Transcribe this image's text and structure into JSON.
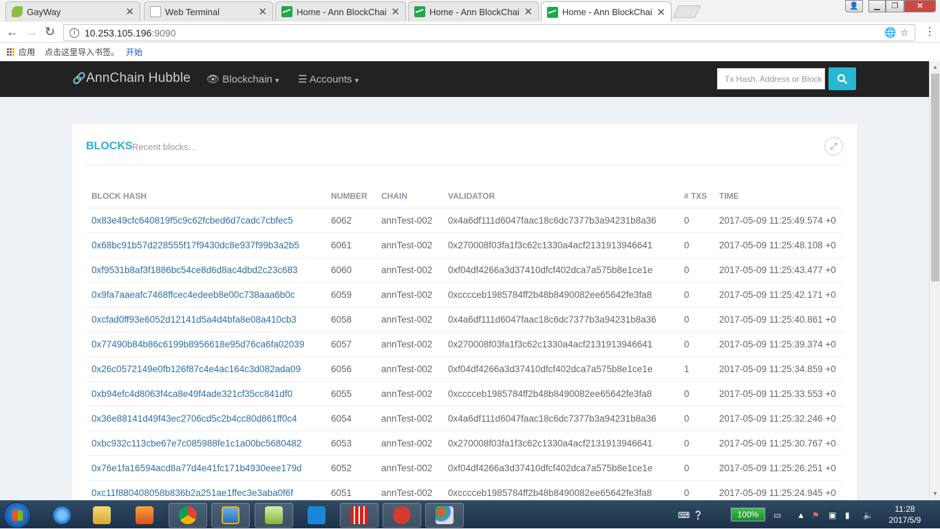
{
  "browser": {
    "tabs": [
      {
        "title": "GayWay",
        "favicon": "leaf-icon",
        "active": false
      },
      {
        "title": "Web Terminal",
        "favicon": "document-icon",
        "active": false
      },
      {
        "title": "Home - Ann BlockChain",
        "favicon": "chart-icon",
        "active": false
      },
      {
        "title": "Home - Ann BlockChain",
        "favicon": "chart-icon",
        "active": false
      },
      {
        "title": "Home - Ann BlockChain",
        "favicon": "chart-icon",
        "active": true
      }
    ],
    "url_host": "10.253.105.196",
    "url_port": ":9090",
    "bookmarks": {
      "apps_label": "应用",
      "import_text": "点击这里导入书签。",
      "start_link": "开始"
    }
  },
  "nav": {
    "brand": "AnnChain Hubble",
    "blockchain_menu": "Blockchain",
    "accounts_menu": "Accounts",
    "search_placeholder": "Tx Hash, Address or Block"
  },
  "card": {
    "title": "BLOCKS",
    "subtitle": "Recent blocks...",
    "columns": [
      "BLOCK HASH",
      "NUMBER",
      "CHAIN",
      "VALIDATOR",
      "# TXS",
      "TIME"
    ],
    "rows": [
      {
        "hash": "0x83e49cfc640819f5c9c62fcbed6d7cadc7cbfec5",
        "number": "6062",
        "chain": "annTest-002",
        "validator": "0x4a6df111d6047faac18c6dc7377b3a94231b8a36",
        "txs": "0",
        "time": "2017-05-09 11:25:49.574 +0"
      },
      {
        "hash": "0x68bc91b57d228555f17f9430dc8e937f99b3a2b5",
        "number": "6061",
        "chain": "annTest-002",
        "validator": "0x270008f03fa1f3c62c1330a4acf2131913946641",
        "txs": "0",
        "time": "2017-05-09 11:25:48.108 +0"
      },
      {
        "hash": "0xf9531b8af3f1886bc54ce8d6d8ac4dbd2c23c683",
        "number": "6060",
        "chain": "annTest-002",
        "validator": "0xf04df4266a3d37410dfcf402dca7a575b8e1ce1e",
        "txs": "0",
        "time": "2017-05-09 11:25:43.477 +0"
      },
      {
        "hash": "0x9fa7aaeafc7468ffcec4edeeb8e00c738aaa6b0c",
        "number": "6059",
        "chain": "annTest-002",
        "validator": "0xcccceb1985784ff2b48b8490082ee65642fe3fa8",
        "txs": "0",
        "time": "2017-05-09 11:25:42.171 +0"
      },
      {
        "hash": "0xcfad0ff93e6052d12141d5a4d4bfa8e08a410cb3",
        "number": "6058",
        "chain": "annTest-002",
        "validator": "0x4a6df111d6047faac18c6dc7377b3a94231b8a36",
        "txs": "0",
        "time": "2017-05-09 11:25:40.861 +0"
      },
      {
        "hash": "0x77490b84b86c6199b8956618e95d76ca6fa02039",
        "number": "6057",
        "chain": "annTest-002",
        "validator": "0x270008f03fa1f3c62c1330a4acf2131913946641",
        "txs": "0",
        "time": "2017-05-09 11:25:39.374 +0"
      },
      {
        "hash": "0x26c0572149e0fb126f87c4e4ac164c3d082ada09",
        "number": "6056",
        "chain": "annTest-002",
        "validator": "0xf04df4266a3d37410dfcf402dca7a575b8e1ce1e",
        "txs": "1",
        "time": "2017-05-09 11:25:34.859 +0"
      },
      {
        "hash": "0xb94efc4d8063f4ca8e49f4ade321cf35cc841df0",
        "number": "6055",
        "chain": "annTest-002",
        "validator": "0xcccceb1985784ff2b48b8490082ee65642fe3fa8",
        "txs": "0",
        "time": "2017-05-09 11:25:33.553 +0"
      },
      {
        "hash": "0x36e88141d49f43ec2706cd5c2b4cc80d861ff0c4",
        "number": "6054",
        "chain": "annTest-002",
        "validator": "0x4a6df111d6047faac18c6dc7377b3a94231b8a36",
        "txs": "0",
        "time": "2017-05-09 11:25:32.246 +0"
      },
      {
        "hash": "0xbc932c113cbe67e7c085988fe1c1a00bc5680482",
        "number": "6053",
        "chain": "annTest-002",
        "validator": "0x270008f03fa1f3c62c1330a4acf2131913946641",
        "txs": "0",
        "time": "2017-05-09 11:25:30.767 +0"
      },
      {
        "hash": "0x76e1fa16594acd8a77d4e41fc171b4930eee179d",
        "number": "6052",
        "chain": "annTest-002",
        "validator": "0xf04df4266a3d37410dfcf402dca7a575b8e1ce1e",
        "txs": "0",
        "time": "2017-05-09 11:25:26.251 +0"
      },
      {
        "hash": "0xc11f880408058b836b2a251ae1ffec3e3aba0f6f",
        "number": "6051",
        "chain": "annTest-002",
        "validator": "0xcccceb1985784ff2b48b8490082ee65642fe3fa8",
        "txs": "0",
        "time": "2017-05-09 11:25:24.945 +0"
      }
    ]
  },
  "taskbar": {
    "battery": "100%",
    "clock_time": "11:28",
    "clock_date": "2017/5/9"
  },
  "colors": {
    "accent": "#25b7d3",
    "navbar": "#222222",
    "link": "#2e6ea5"
  }
}
